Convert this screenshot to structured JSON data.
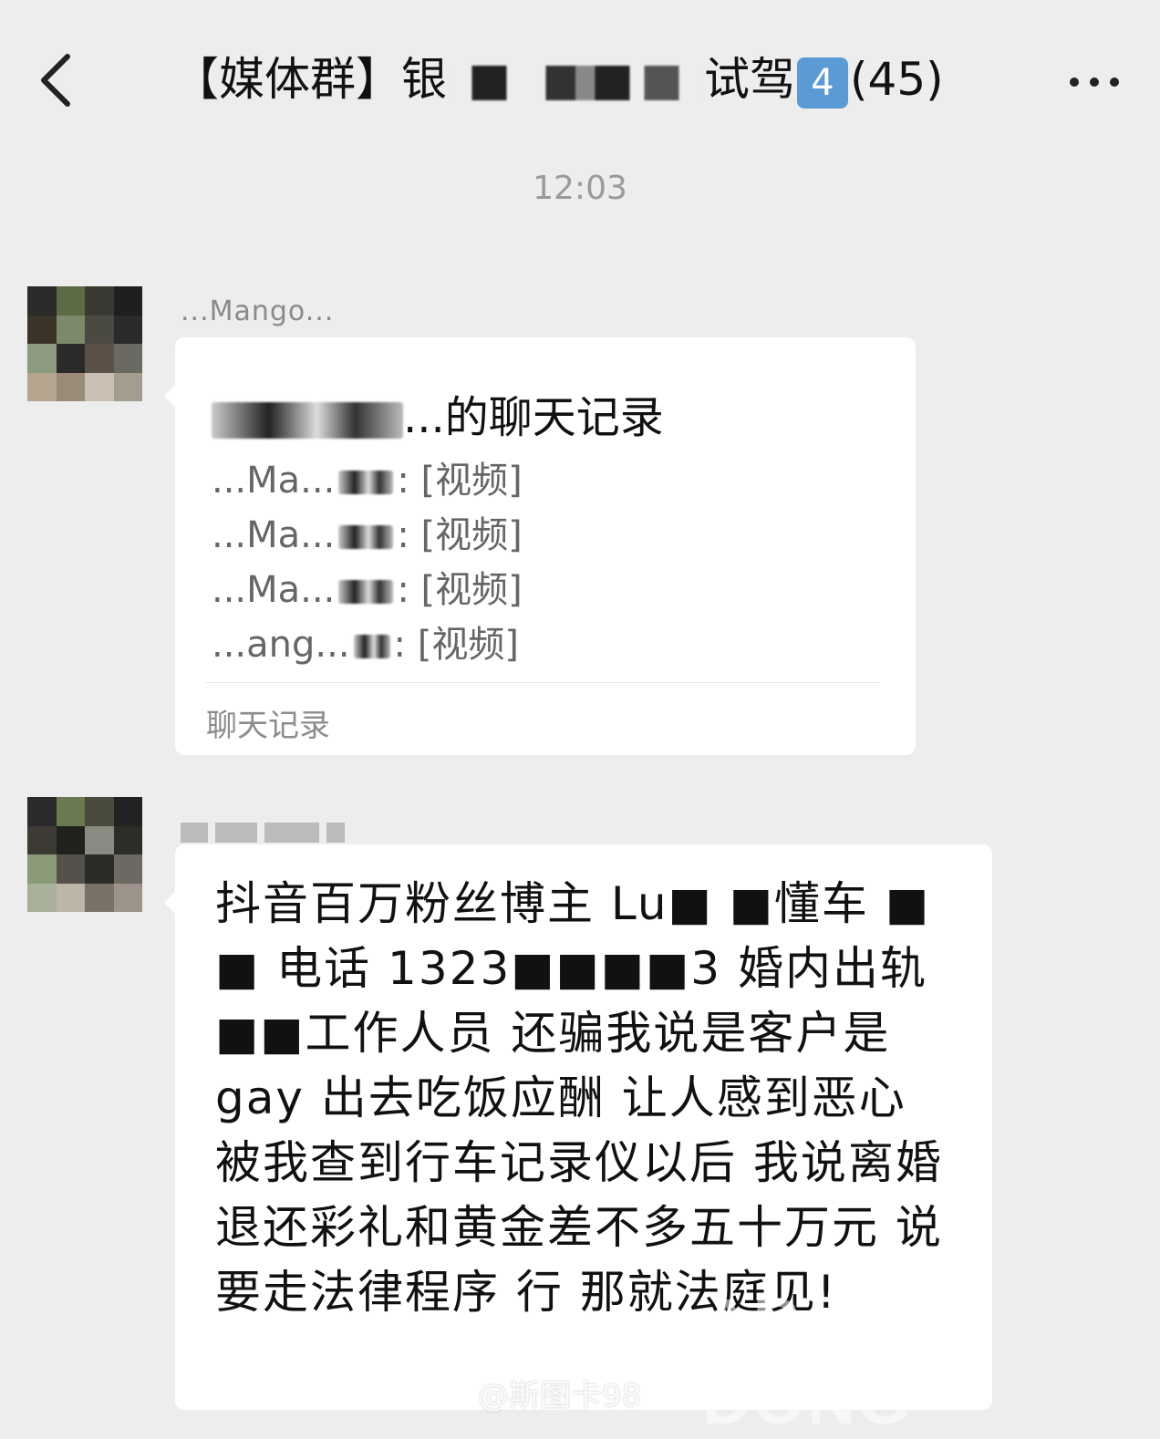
{
  "header": {
    "title_prefix": "【媒体群】银",
    "title_suffix": "试驾",
    "badge": "4",
    "member_count": "(45)"
  },
  "timestamp": "12:03",
  "messages": [
    {
      "sender": "...Mango...",
      "card": {
        "title_suffix": "...的聊天记录",
        "lines": [
          {
            "name": "...Ma...",
            "content": ": [视频]"
          },
          {
            "name": "...Ma...",
            "content": ": [视频]"
          },
          {
            "name": "...Ma...",
            "content": ": [视频]"
          },
          {
            "name": "...ang...",
            "content": ": [视频]"
          }
        ],
        "footer": "聊天记录"
      }
    },
    {
      "sender": "",
      "text": "抖音百万粉丝博主 Lu■ ■懂车 ■ ■ 电话 1323■■■■3 婚内出轨■■工作人员 还骗我说是客户是gay 出去吃饭应酬 让人感到恶心 被我查到行车记录仪以后 我说离婚 退还彩礼和黄金差不多五十万元 说要走法律程序 行 那就法庭见!"
    }
  ],
  "overlay": {
    "watermark": "AB KUAI DONG",
    "weibo_credit": "@斯图卡98"
  }
}
